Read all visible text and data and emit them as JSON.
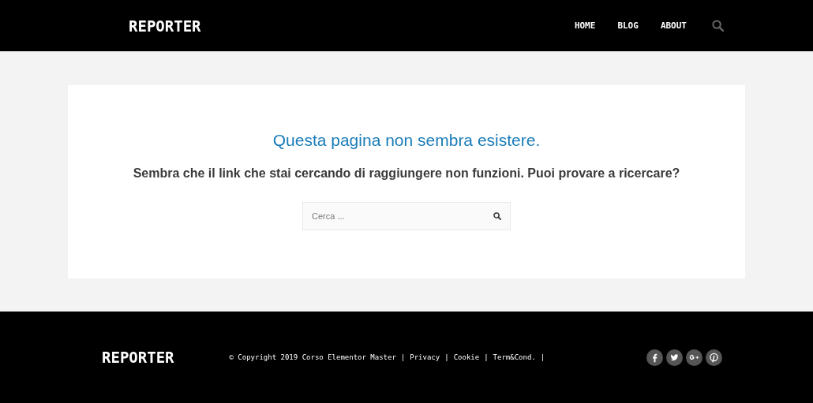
{
  "header": {
    "logo": "REPORTER",
    "nav": [
      {
        "label": "HOME"
      },
      {
        "label": "BLOG"
      },
      {
        "label": "ABOUT"
      }
    ]
  },
  "error": {
    "title": "Questa pagina non sembra esistere.",
    "message": "Sembra che il link che stai cercando di raggiungere non funzioni. Puoi provare a ricercare?",
    "search": {
      "placeholder": "Cerca ..."
    }
  },
  "footer": {
    "logo": "REPORTER",
    "copyright": "© Copyright 2019 Corso Elementor Master",
    "links": [
      {
        "label": "Privacy"
      },
      {
        "label": "Cookie"
      },
      {
        "label": "Term&Cond."
      }
    ],
    "separator": "|",
    "social": [
      {
        "kind": "facebook"
      },
      {
        "kind": "twitter"
      },
      {
        "kind": "googleplus"
      },
      {
        "kind": "pinterest"
      }
    ]
  }
}
